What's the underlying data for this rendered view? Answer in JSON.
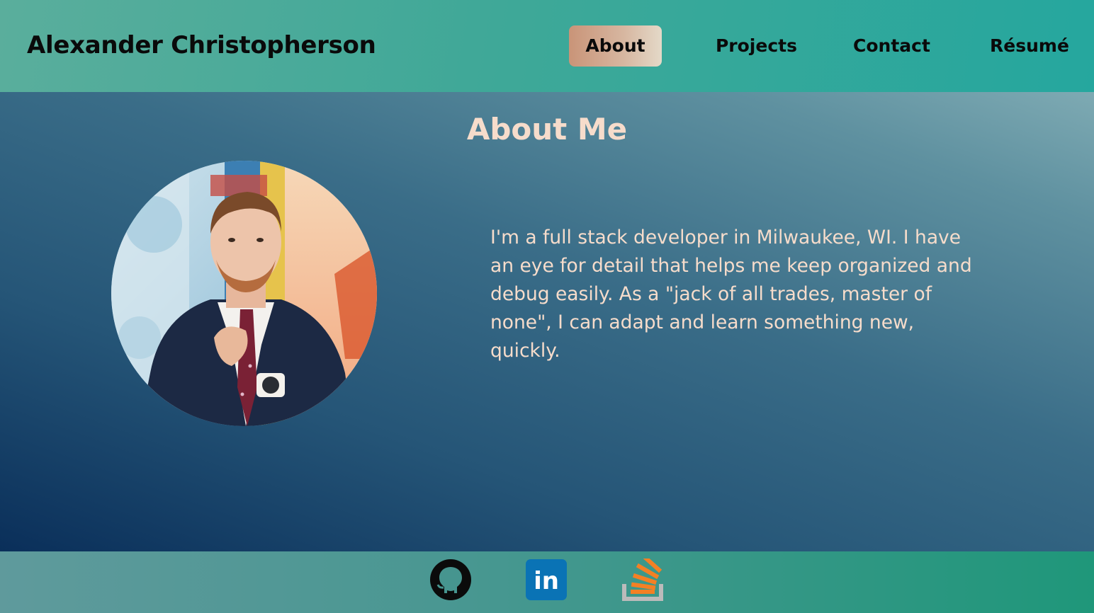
{
  "header": {
    "brand": "Alexander Christopherson",
    "nav": {
      "about": "About",
      "projects": "Projects",
      "contact": "Contact",
      "resume": "Résumé"
    },
    "active_tab": "About"
  },
  "about": {
    "title": "About Me",
    "bio": "I'm a full stack developer in Milwaukee, WI. I have an eye for detail that helps me keep organized and debug easily. As a \"jack of all trades, master of none\", I can adapt and learn something new, quickly."
  },
  "footer": {
    "links": [
      {
        "icon": "github-icon"
      },
      {
        "icon": "linkedin-icon",
        "text": "in"
      },
      {
        "icon": "stackoverflow-icon"
      }
    ]
  },
  "colors": {
    "accent_text": "#f6dccb",
    "active_tab_bg": "#c99478",
    "header_bg": "#3fa898",
    "footer_bg": "#1f977a",
    "linkedin_blue": "#0a73b5",
    "stackoverflow_orange": "#f48024",
    "stackoverflow_gray": "#bcbbbb"
  }
}
